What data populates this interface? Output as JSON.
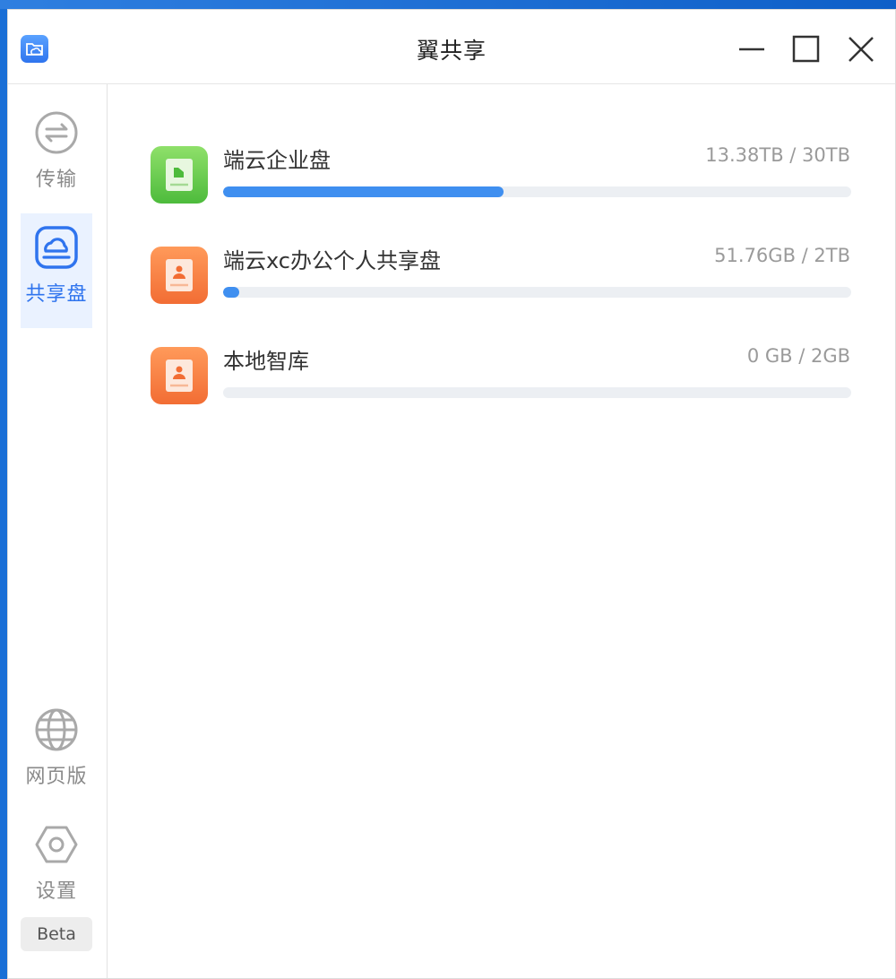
{
  "window": {
    "title": "翼共享"
  },
  "sidebar": {
    "items": [
      {
        "label": "传输",
        "icon": "transfer-icon",
        "active": false
      },
      {
        "label": "共享盘",
        "icon": "shared-disk-icon",
        "active": true
      },
      {
        "label": "网页版",
        "icon": "globe-icon",
        "active": false
      },
      {
        "label": "设置",
        "icon": "settings-hexagon-icon",
        "active": false
      }
    ],
    "beta_label": "Beta"
  },
  "disks": [
    {
      "name": "端云企业盘",
      "usage": "13.38TB / 30TB",
      "used_fraction": 0.446,
      "icon": "enterprise-disk-icon",
      "color": "#5cc84a"
    },
    {
      "name": "端云xc办公个人共享盘",
      "usage": "51.76GB / 2TB",
      "used_fraction": 0.026,
      "icon": "personal-disk-icon",
      "color": "#f57a3d"
    },
    {
      "name": "本地智库",
      "usage": "0 GB / 2GB",
      "used_fraction": 0.0,
      "icon": "personal-disk-icon",
      "color": "#f57a3d"
    }
  ],
  "colors": {
    "accent": "#2f74ee",
    "progress": "#3f8ff0",
    "track": "#eceff3"
  }
}
